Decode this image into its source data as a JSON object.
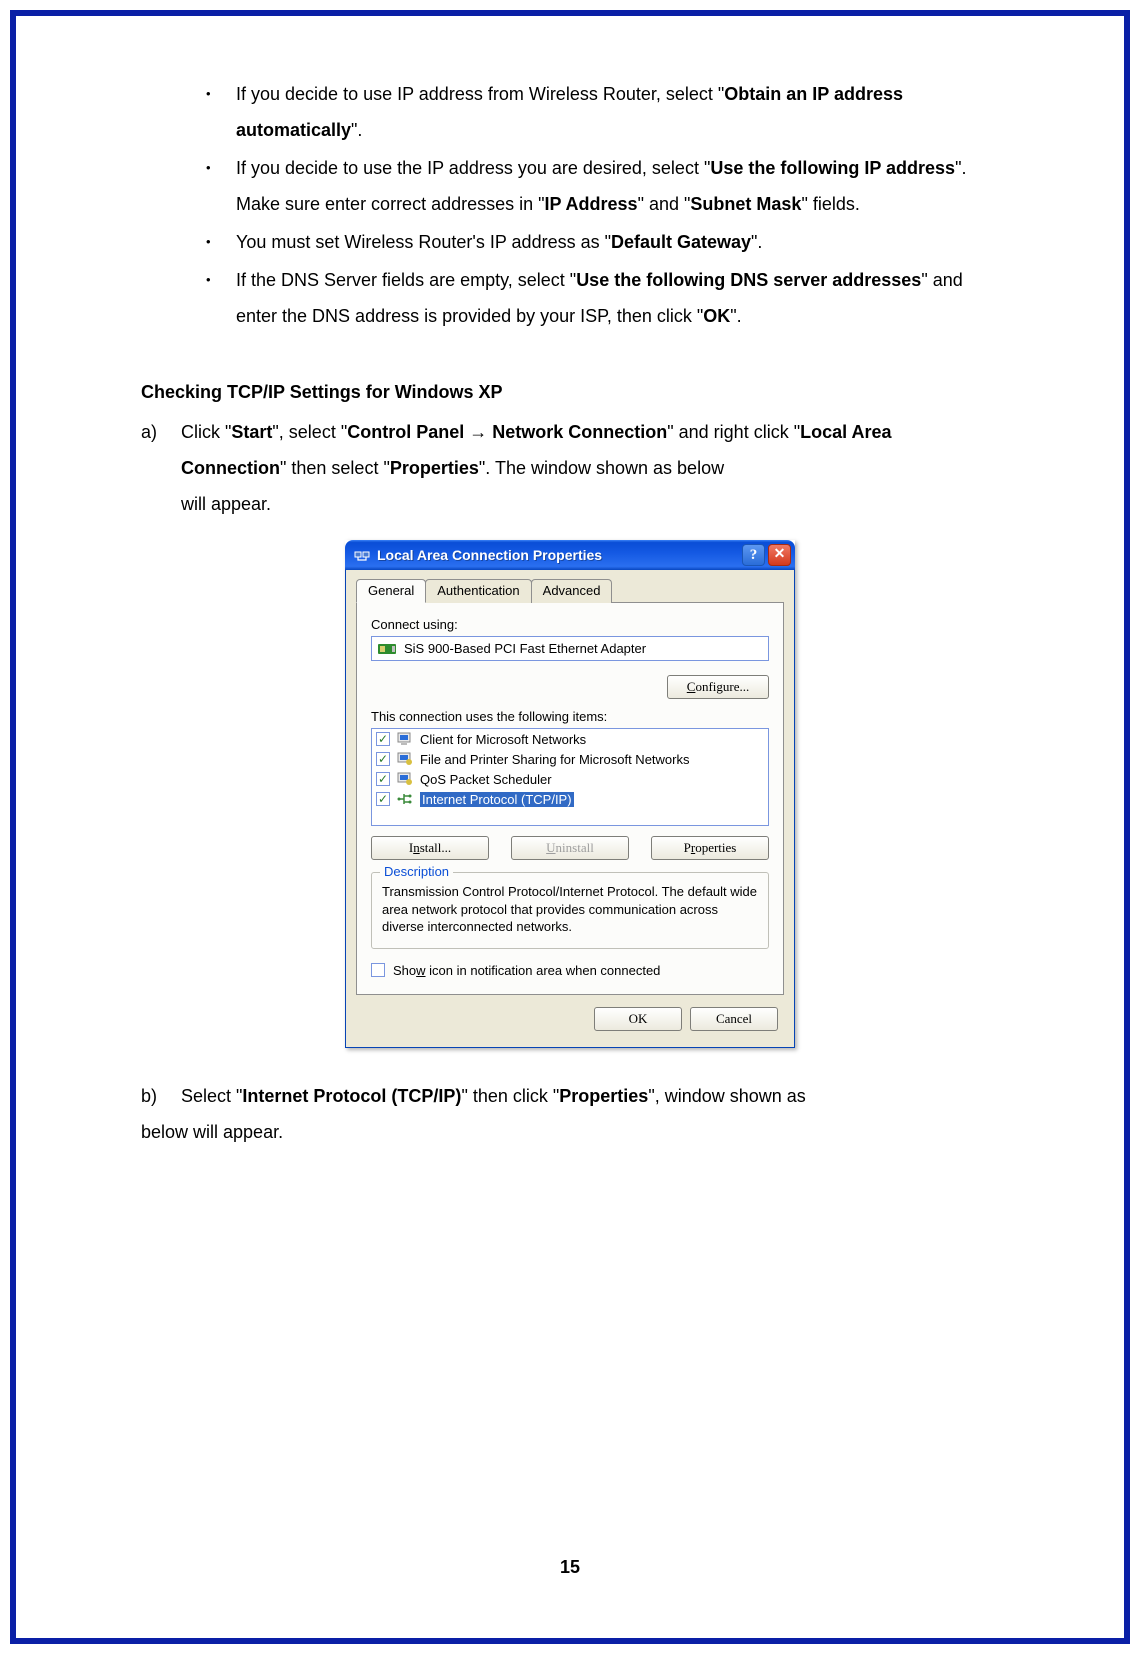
{
  "bullets": {
    "b1_pre": "If you decide to use IP address from Wireless Router, select \"",
    "b1_bold": "Obtain an IP address automatically",
    "b1_post": "\".",
    "b2_pre": "If you decide to use the IP address you are desired, select \"",
    "b2_bold1": "Use the following IP address",
    "b2_mid": "\".    Make sure enter correct addresses in \"",
    "b2_bold2": "IP Address",
    "b2_mid2": "\" and \"",
    "b2_bold3": "Subnet Mask",
    "b2_post": "\" fields.",
    "b3_pre": "You must set Wireless Router's IP address as \"",
    "b3_bold": "Default Gateway",
    "b3_post": "\".",
    "b4_pre": "If the DNS Server fields are empty, select \"",
    "b4_bold1": "Use the following DNS server addresses",
    "b4_mid": "\" and enter the DNS address is provided by your ISP, then click \"",
    "b4_bold2": "OK",
    "b4_post": "\"."
  },
  "heading": "Checking TCP/IP Settings for Windows XP",
  "step_a": {
    "label": "a)",
    "t1": "Click \"",
    "b1": "Start",
    "t2": "\", select \"",
    "b2": "Control Panel → Network Connection",
    "t3": "\" and right click \"",
    "b3": "Local Area Connection",
    "t4": "\" then select \"",
    "b4": "Properties",
    "t5": "\".    The window shown as below",
    "t6": "will appear."
  },
  "dialog": {
    "title": "Local Area Connection Properties",
    "tabs": {
      "general": "General",
      "auth": "Authentication",
      "adv": "Advanced"
    },
    "connect_using": "Connect using:",
    "adapter": "SiS 900-Based PCI Fast Ethernet Adapter",
    "configure": "Configure...",
    "uses_items": "This connection uses the following items:",
    "items": {
      "i0": "Client for Microsoft Networks",
      "i1": "File and Printer Sharing for Microsoft Networks",
      "i2": "QoS Packet Scheduler",
      "i3": "Internet Protocol (TCP/IP)"
    },
    "install": "Install...",
    "uninstall": "Uninstall",
    "properties": "Properties",
    "desc_legend": "Description",
    "desc_text": "Transmission Control Protocol/Internet Protocol. The default wide area network protocol that provides communication across diverse interconnected networks.",
    "show_icon": "Show icon in notification area when connected",
    "ok": "OK",
    "cancel": "Cancel"
  },
  "step_b": {
    "label": "b)",
    "t1": "Select \"",
    "b1": "Internet Protocol (TCP/IP)",
    "t2": "\" then click \"",
    "b2": "Properties",
    "t3": "\", window shown as"
  },
  "after_b": "below will appear.",
  "page_number": "15"
}
